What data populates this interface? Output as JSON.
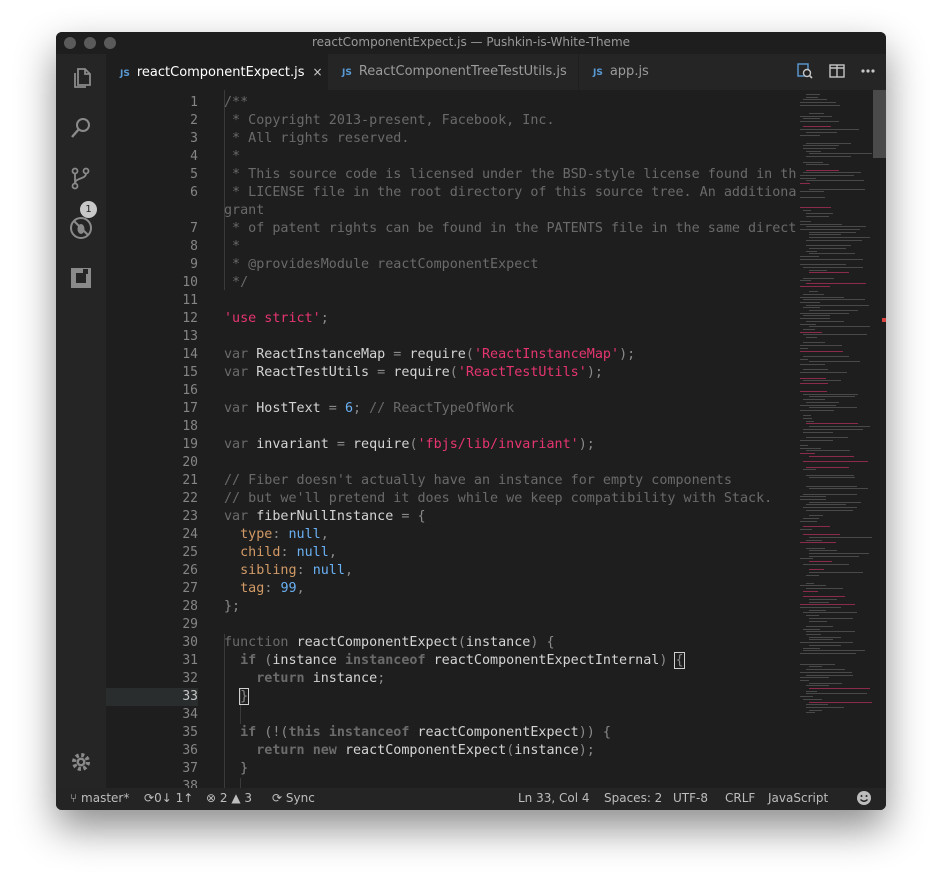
{
  "window": {
    "title": "reactComponentExpect.js — Pushkin-is-White-Theme"
  },
  "activity": {
    "scm_badge": "1"
  },
  "tabs": [
    {
      "icon": "JS",
      "label": "reactComponentExpect.js",
      "close": "×"
    },
    {
      "icon": "JS",
      "label": "ReactComponentTreeTestUtils.js"
    },
    {
      "icon": "JS",
      "label": "app.js"
    }
  ],
  "editor": {
    "line_numbers": [
      "1",
      "2",
      "3",
      "4",
      "5",
      "6",
      "",
      "7",
      "8",
      "9",
      "10",
      "11",
      "12",
      "13",
      "14",
      "15",
      "16",
      "17",
      "18",
      "19",
      "20",
      "21",
      "22",
      "23",
      "24",
      "25",
      "26",
      "27",
      "28",
      "29",
      "30",
      "31",
      "32",
      "33",
      "34",
      "35",
      "36",
      "37",
      "38"
    ],
    "lines": [
      "/**",
      " * Copyright 2013-present, Facebook, Inc.",
      " * All rights reserved.",
      " *",
      " * This source code is licensed under the BSD-style license found in the",
      " * LICENSE file in the root directory of this source tree. An additional",
      "grant",
      " * of patent rights can be found in the PATENTS file in the same directory.",
      " *",
      " * @providesModule reactComponentExpect",
      " */",
      "",
      "'use strict';",
      "",
      "var ReactInstanceMap = require('ReactInstanceMap');",
      "var ReactTestUtils = require('ReactTestUtils');",
      "",
      "var HostText = 6; // ReactTypeOfWork",
      "",
      "var invariant = require('fbjs/lib/invariant');",
      "",
      "// Fiber doesn't actually have an instance for empty components",
      "// but we'll pretend it does while we keep compatibility with Stack.",
      "var fiberNullInstance = {",
      "  type: null,",
      "  child: null,",
      "  sibling: null,",
      "  tag: 99,",
      "};",
      "",
      "function reactComponentExpect(instance) {",
      "  if (instance instanceof reactComponentExpectInternal) {",
      "    return instance;",
      "  }",
      "",
      "  if (!(this instanceof reactComponentExpect)) {",
      "    return new reactComponentExpect(instance);",
      "  }",
      ""
    ],
    "current_line": "33"
  },
  "status": {
    "branch": "master*",
    "sync_counts": "0↓ 1↑",
    "errors": "2",
    "warnings": "3",
    "sync_label": "Sync",
    "cursor_pos": "Ln 33, Col 4",
    "indent": "Spaces: 2",
    "encoding": "UTF-8",
    "eol": "CRLF",
    "language": "JavaScript"
  },
  "colors": {
    "background": "#1e1e1e",
    "string": "#e6356e",
    "number": "#6ab0f3",
    "property": "#d19a66",
    "comment": "#6a6a6a"
  }
}
